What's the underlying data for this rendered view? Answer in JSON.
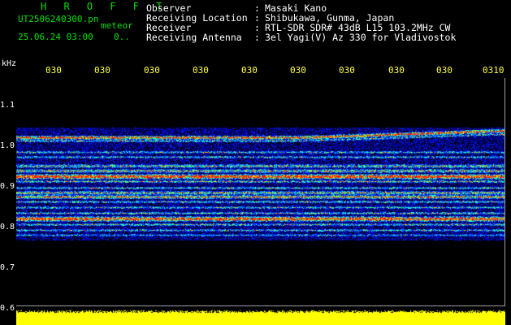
{
  "header": {
    "brand": "H R O F F T",
    "file_name": "UT2506240300.pn",
    "meteor_label": "meteor",
    "datetime": "25.06.24 03:00",
    "count": "0..",
    "rows": [
      {
        "label": "Observer",
        "value": "Masaki Kano"
      },
      {
        "label": "Receiving Location",
        "value": "Shibukawa, Gunma, Japan"
      },
      {
        "label": "Receiver",
        "value": "RTL-SDR SDR# 43dB L15 103.2MHz CW"
      },
      {
        "label": "Receiving Antenna",
        "value": "3el Yagi(V) Az 330 for Vladivostok"
      }
    ]
  },
  "spectrogram": {
    "y_unit": "kHz",
    "y_ticks": [
      "1.1",
      "1.0",
      "0.9",
      "0.8",
      "0.7",
      "0.6"
    ],
    "x_ticks": [
      "030",
      "030",
      "030",
      "030",
      "030",
      "030",
      "030",
      "030",
      "030",
      "0310"
    ],
    "band_color_low": "#0000b0",
    "band_color_mid": "#00ffff",
    "band_color_high": "#ff2000",
    "power_color": "#ffff00"
  }
}
